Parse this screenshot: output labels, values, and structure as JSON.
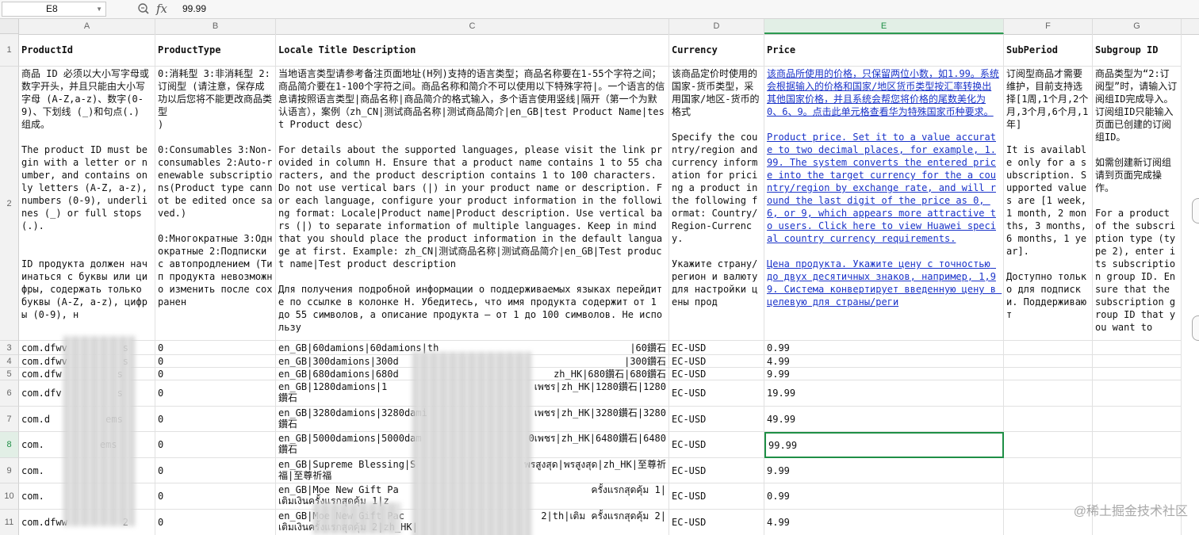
{
  "formula_bar": {
    "cell_ref": "E8",
    "fx_label": "fx",
    "value": "99.99"
  },
  "col_letters": [
    "A",
    "B",
    "C",
    "D",
    "E",
    "F",
    "G"
  ],
  "selected_col": "E",
  "header_row": {
    "num": "1",
    "cells": [
      "ProductId",
      "ProductType",
      "Locale Title Description",
      "Currency",
      "Price",
      "SubPeriod",
      "Subgroup ID"
    ]
  },
  "desc_row": {
    "num": "2",
    "A": "商品 ID 必须以大小写字母或数字开头，并且只能由大小写字母 (A-Z,a-z)、数字(0-9)、下划线 (_)和句点(.) 组成。\n\nThe product ID must begin with a letter or number, and contains only letters (A-Z, a-z), numbers (0-9), underlines (_) or full stops (.).\n\n\nID продукта должен начинаться с буквы или цифры, содержать только буквы (A-Z, a-z), цифры (0-9), н",
    "B": "0:消耗型 3:非消耗型 2:订阅型 (请注意，保存成功以后您将不能更改商品类型\n)\n\n0:Consumables 3:Non-consumables 2:Auto-renewable subscriptions(Product type cannot be edited once saved.)\n\n0:Многократные 3:Однократные 2:Подписки с автопродлением (Тип продукта невозможно изменить после сохранен",
    "C": "当地语言类型请参考备注页面地址(H列)支持的语言类型；商品名称要在1-55个字符之间；商品简介要在1-100个字符之间。商品名称和简介不可以使用以下特殊字符|。一个语言的信息请按照语言类型|商品名称|商品简介的格式输入，多个语言使用竖线|隔开（第一个为默认语言），案例（zh_CN|测试商品名称|测试商品简介|en_GB|test Product Name|test Product desc）\n\nFor details about the supported languages, please visit the link provided in column H. Ensure that a product name contains 1 to 55 characters, and the product description contains 1 to 100 characters. Do not use vertical bars (|) in your product name or description. For each language, configure your product information in the following format: Locale|Product name|Product description. Use vertical bars (|) to separate information of multiple languages. Keep in mind that you should place the product information in the default language at first. Example: zh_CN|测试商品名称|测试商品简介|en_GB|Test product name|Test product description\n\nДля получения подробной информации о поддерживаемых языках перейдите по ссылке в колонке H. Убедитесь, что имя продукта содержит от 1 до 55 символов, а описание продукта — от 1 до 100 символов. Не использу",
    "D": "该商品定价时使用的国家-货币类型，采用国家/地区-货币的格式\n\nSpecify the country/region and currency information for pricing a product in the following format: Country/Region-Currency.\n\nУкажите страну/регион и валюту для настройки цены прод",
    "E": "该商品所使用的价格，只保留两位小数，如1.99。系统会根据输入的价格和国家/地区货币类型按汇率转换出其他国家价格，并且系统会帮您将价格的尾数美化为0、6、9。点击此单元格查看华为特殊国家币种要求。\n\nProduct price. Set it to a value accurate to two decimal places, for example, 1.99. The system converts the entered price into the target currency for the a country/region by exchange rate, and will round the last digit of the price as 0, 6, or 9, which appears more attractive to users. Click here to view Huawei special country currency requirements.\n\nЦена продукта. Укажите цену с точностью до двух десятичных знаков, например, 1,99. Система конвертирует введенную цену в целевую для страны/реги",
    "F": "订阅型商品才需要维护，目前支持选择[1周,1个月,2个月,3个月,6个月,1年]\n\nIt is available only for a subscription. Supported values are [1 week, 1 month, 2 months, 3 months, 6 months, 1 year].\n\nДоступно только для подписки. Поддерживают",
    "G": "商品类型为“2:订阅型”时，请输入订阅组ID完成导入。订阅组ID只能输入页面已创建的订阅组ID。\n\n如需创建新订阅组请到页面完成操作。\n\nFor a product of the subscription type (type 2), enter its subscription group ID. Ensure that the subscription group ID that you want to"
  },
  "data_rows": [
    {
      "num": "3",
      "A": "com.dfwv",
      "Atail": "s",
      "B": "0",
      "C": "en_GB|60damions|60damions|th",
      "Ctail": "|60鑽石",
      "D": "EC-USD",
      "E": "0.99"
    },
    {
      "num": "4",
      "A": "com.dfwv",
      "Atail": "s",
      "B": "0",
      "C": "en_GB|300damions|300d",
      "Ctail": "|300鑽石",
      "D": "EC-USD",
      "E": "4.99"
    },
    {
      "num": "5",
      "A": "com.dfw",
      "Atail": "s",
      "B": "0",
      "C": "en_GB|680damions|680d",
      "Ctail": "zh_HK|680鑽石|680鑽石",
      "D": "EC-USD",
      "E": "9.99"
    },
    {
      "num": "6",
      "A": "com.dfv",
      "Atail": "s",
      "B": "0",
      "C": "en_GB|1280damions|1",
      "Ctail": "เพชร|zh_HK|1280鑽石|1280",
      "C2": "鑽石",
      "D": "EC-USD",
      "E": "19.99"
    },
    {
      "num": "7",
      "A": "com.d",
      "Atail": "ems",
      "B": "0",
      "C": "en_GB|3280damions|3280dami",
      "Ctail": "เพชร|zh_HK|3280鑽石|3280",
      "C2": "鑽石",
      "D": "EC-USD",
      "E": "49.99"
    },
    {
      "num": "8",
      "A": "com.",
      "Atail": "ems",
      "B": "0",
      "C": "en_GB|5000damions|5000dam",
      "Ctail": "0เพชร|zh_HK|6480鑽石|6480",
      "C2": "鑽石",
      "D": "EC-USD",
      "E": "99.99"
    },
    {
      "num": "9",
      "A": "com.",
      "Atail": "",
      "B": "0",
      "C": "en_GB|Supreme Blessing|S",
      "Ctail": "พรสูงสุด|พรสูงสุด|zh_HK|至尊祈",
      "C2": "福|至尊祈福",
      "D": "EC-USD",
      "E": "9.99"
    },
    {
      "num": "10",
      "A": "com.",
      "Atail": "",
      "B": "0",
      "C": "en_GB|Moe New Gift Pa",
      "Ctail": "ครั้งแรกสุดคุ้ม 1|",
      "C2": "เติมเงินครั้งแรกสุดคุ้ม 1|z",
      "D": "EC-USD",
      "E": "0.99"
    },
    {
      "num": "11",
      "A": "com.dfww",
      "Atail": "2",
      "B": "0",
      "C": "en_GB|Moe New Gift Pac",
      "Ctail": "2|th|เติม ครั้งแรกสุดคุ้ม 2|",
      "C2": "เติมเงินครั้งแรกสุดคุ้ม 2|zh_HK|",
      "D": "EC-USD",
      "E": "4.99"
    }
  ],
  "watermark": "@稀土掘金技术社区"
}
